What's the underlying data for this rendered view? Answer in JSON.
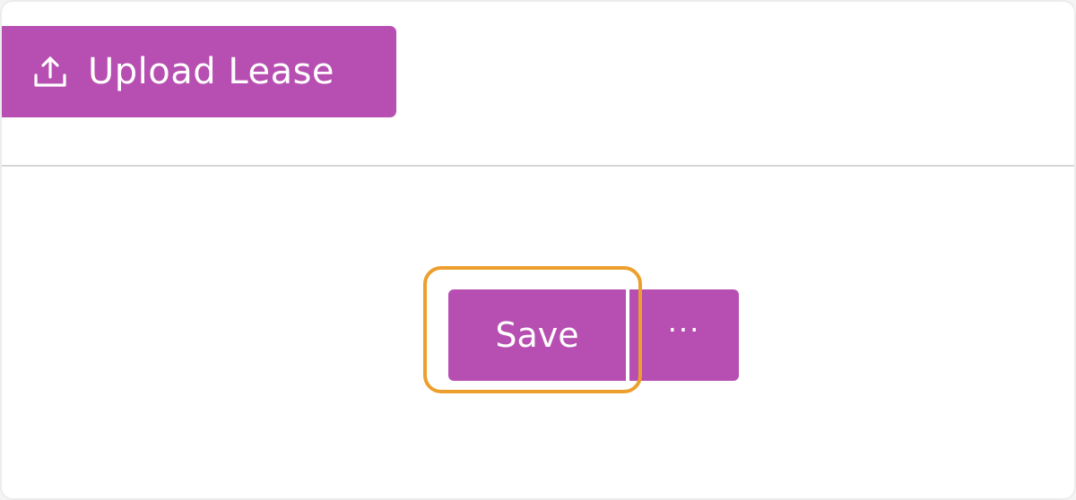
{
  "toolbar": {
    "upload_label": "Upload Lease",
    "upload_icon": "upload-icon"
  },
  "actions": {
    "save_label": "Save",
    "more_label": "···",
    "more_icon": "more-options-icon"
  },
  "colors": {
    "accent": "#b64fb1",
    "highlight": "#ec9f2c",
    "divider": "#d6d6d6"
  }
}
